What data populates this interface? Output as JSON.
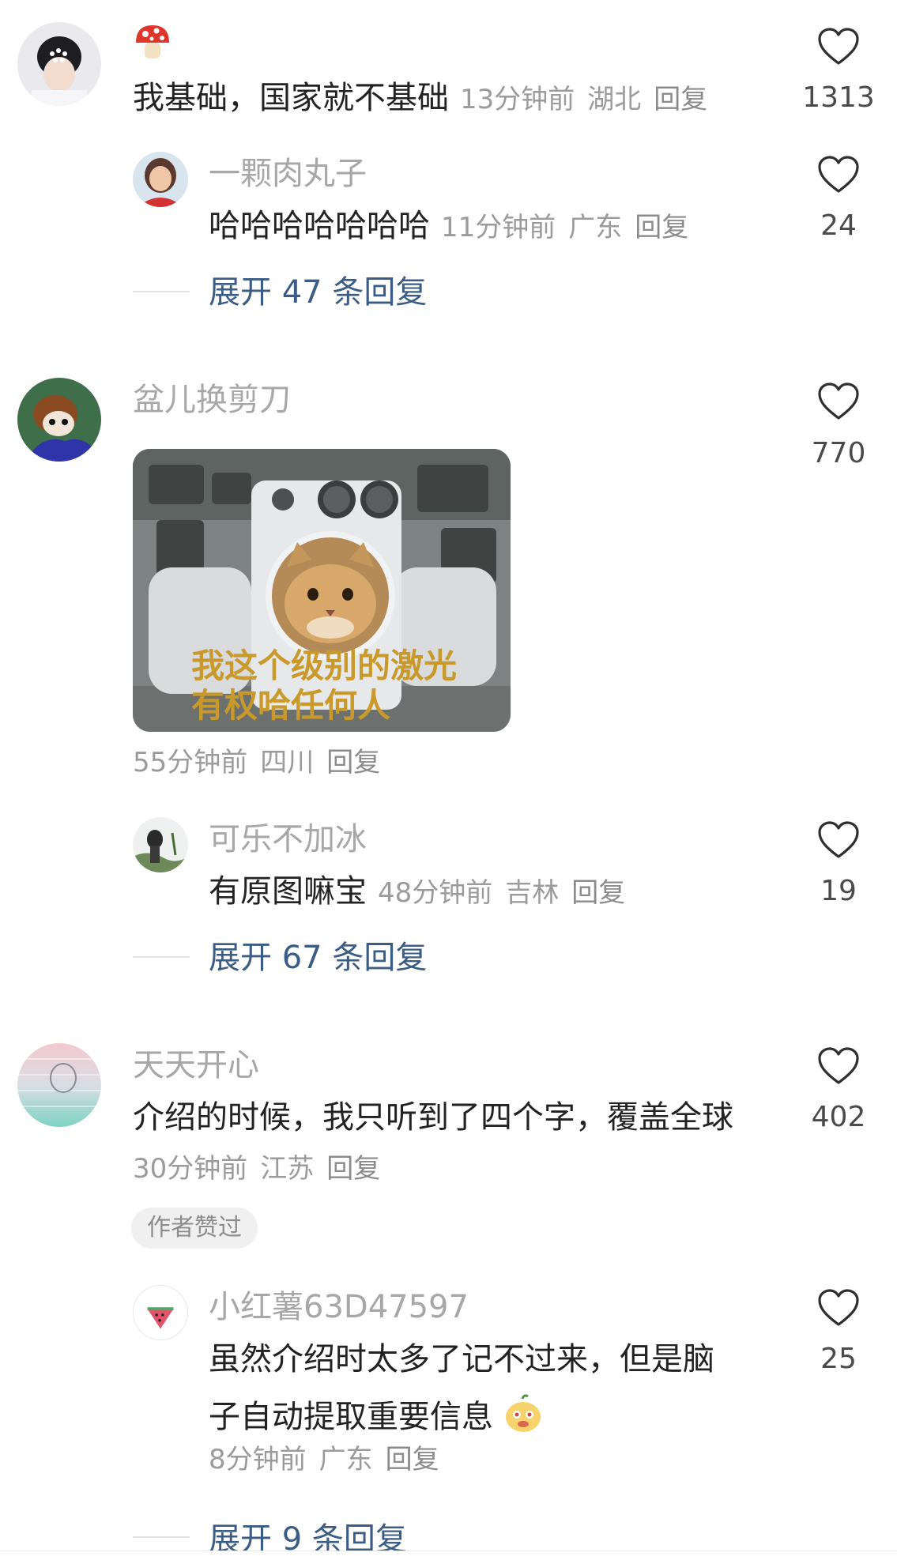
{
  "comments": [
    {
      "name": "",
      "text": "我基础，国家就不基础",
      "time": "13分钟前",
      "location": "湖北",
      "reply_label": "回复",
      "likes": "1313",
      "sub": {
        "name": "一颗肉丸子",
        "text": "哈哈哈哈哈哈哈",
        "time": "11分钟前",
        "location": "广东",
        "reply_label": "回复",
        "likes": "24"
      },
      "expand_label": "展开 47 条回复"
    },
    {
      "name": "盆儿换剪刀",
      "image_caption_line1": "我这个级别的激光",
      "image_caption_line2": "有权哈任何人",
      "time": "55分钟前",
      "location": "四川",
      "reply_label": "回复",
      "likes": "770",
      "sub": {
        "name": "可乐不加冰",
        "text": "有原图嘛宝",
        "time": "48分钟前",
        "location": "吉林",
        "reply_label": "回复",
        "likes": "19"
      },
      "expand_label": "展开 67 条回复"
    },
    {
      "name": "天天开心",
      "text": "介绍的时候，我只听到了四个字，覆盖全球",
      "time": "30分钟前",
      "location": "江苏",
      "reply_label": "回复",
      "likes": "402",
      "badge": "作者赞过",
      "sub": {
        "name": "小红薯63D47597",
        "text_line1": "虽然介绍时太多了记不过来，但是脑",
        "text_line2": "子自动提取重要信息",
        "time": "8分钟前",
        "location": "广东",
        "reply_label": "回复",
        "likes": "25"
      },
      "expand_label": "展开 9 条回复"
    }
  ],
  "icons": {
    "like": "heart-outline-icon",
    "name_badge": "mushroom-icon",
    "emoji": "yellow-face-emoji"
  },
  "colors": {
    "expand_link": "#3b5c84",
    "meta_text": "#9b9b9b",
    "name_text": "#a7a7a7"
  }
}
